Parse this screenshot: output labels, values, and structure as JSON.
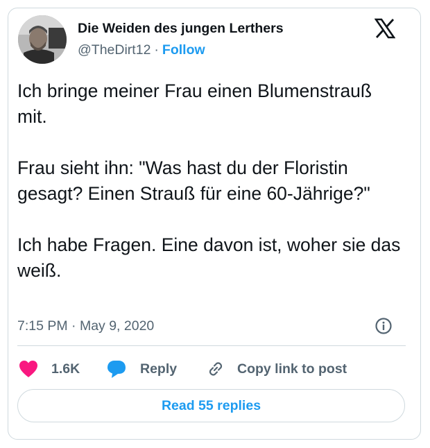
{
  "author": {
    "display_name": "Die Weiden des jungen Lerthers",
    "handle": "@TheDirt12",
    "separator": "·",
    "follow_label": "Follow",
    "avatar": "avatar-photo"
  },
  "platform_icon": "x-logo-icon",
  "tweet": {
    "paragraphs": [
      "Ich bringe meiner Frau einen Blumenstrauß mit.",
      "Frau sieht ihn: \"Was hast du der Floristin gesagt? Einen Strauß für eine 60-Jährige?\"",
      "Ich habe Fragen. Eine davon ist, woher sie das weiß."
    ],
    "timestamp": "7:15 PM · May 9, 2020"
  },
  "actions": {
    "like_count": "1.6K",
    "reply_label": "Reply",
    "copy_label": "Copy link to post"
  },
  "read_replies_label": "Read 55 replies",
  "colors": {
    "text": "#0f1419",
    "muted": "#536471",
    "accent": "#1d9bf0",
    "like": "#f91880",
    "border": "#cfd9de"
  }
}
